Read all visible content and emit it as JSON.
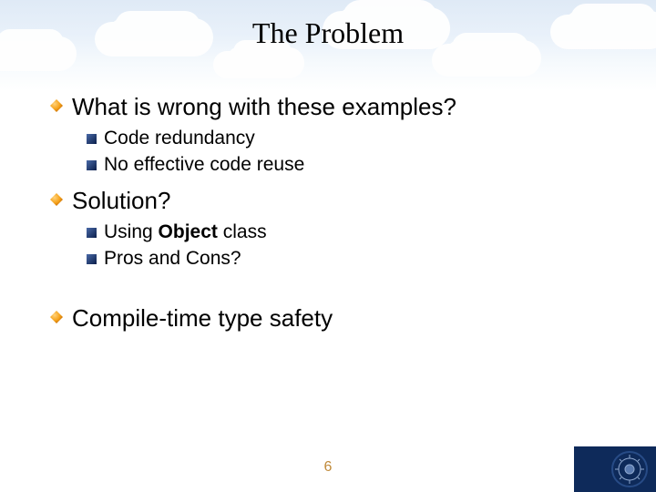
{
  "title": "The Problem",
  "items": {
    "q1": {
      "text": "What is wrong with these examples?"
    },
    "q1_sub": {
      "a": "Code redundancy",
      "b": "No effective code reuse"
    },
    "q2": {
      "text": "Solution?"
    },
    "q2_sub": {
      "a_pre": "Using ",
      "a_bold": "Object",
      "a_post": " class",
      "b": "Pros and Cons?"
    },
    "q3": {
      "text": "Compile-time type safety"
    }
  },
  "page_number": "6"
}
